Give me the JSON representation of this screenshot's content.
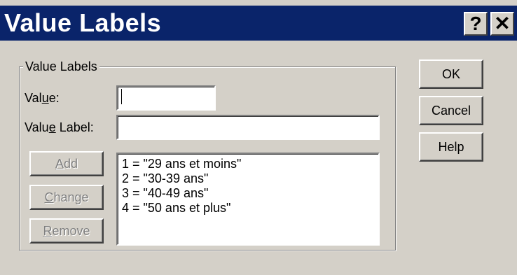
{
  "window": {
    "title": "Value Labels",
    "help_button": "?",
    "close_button": "✕"
  },
  "group": {
    "legend": "Value Labels"
  },
  "fields": {
    "value": {
      "label_pre": "Val",
      "label_key": "u",
      "label_post": "e:",
      "value": ""
    },
    "value_label": {
      "label_pre": "Valu",
      "label_key": "e",
      "label_post": " Label:",
      "value": ""
    }
  },
  "side_buttons": {
    "add": {
      "key": "A",
      "rest": "dd",
      "enabled": false
    },
    "change": {
      "key": "C",
      "rest": "hange",
      "enabled": false
    },
    "remove": {
      "key": "R",
      "rest": "emove",
      "enabled": false
    }
  },
  "list_items": [
    "1 = \"29 ans et moins\"",
    "2 = \"30-39 ans\"",
    "3 = \"40-49 ans\"",
    "4 = \"50 ans et plus\""
  ],
  "main_buttons": {
    "ok": "OK",
    "cancel": "Cancel",
    "help": "Help"
  }
}
